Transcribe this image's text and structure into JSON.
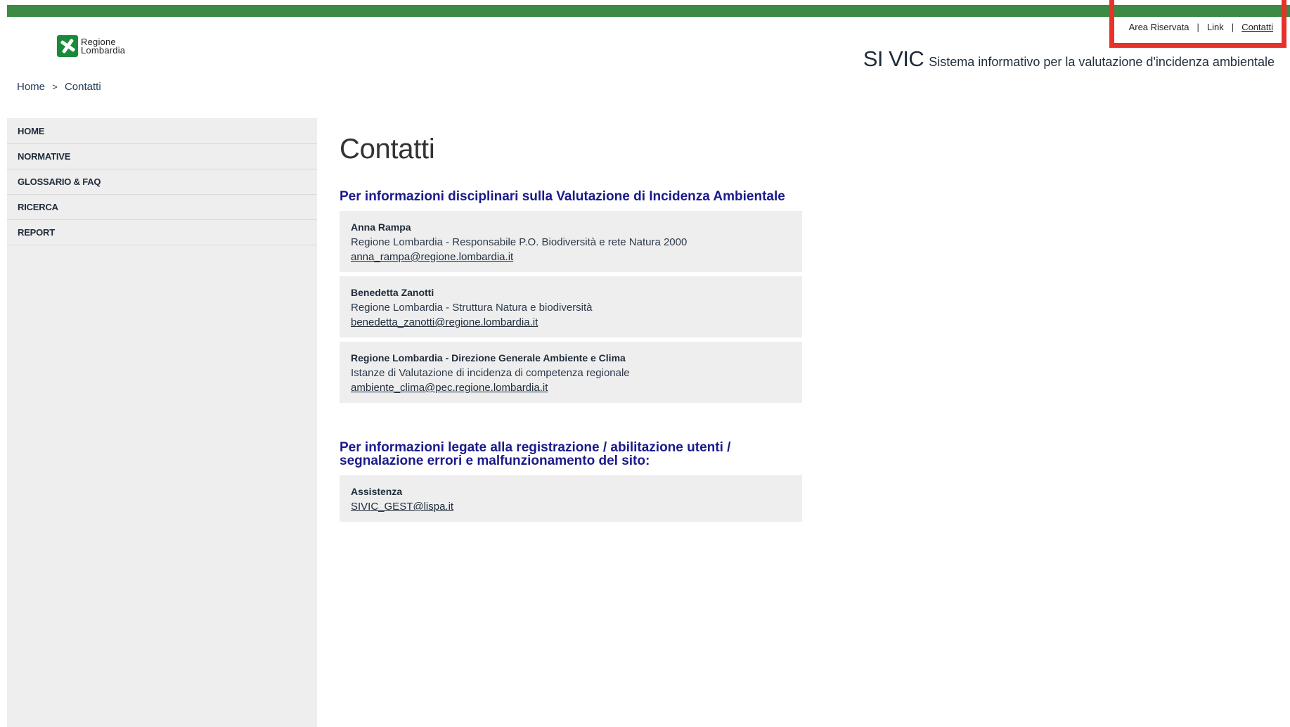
{
  "logo": {
    "line1": "Regione",
    "line2": "Lombardia"
  },
  "utility_links": [
    {
      "label": "Area Riservata"
    },
    {
      "label": "Link"
    },
    {
      "label": "Contatti"
    }
  ],
  "utility_separator": "|",
  "site_title": {
    "short": "SI VIC",
    "long": "Sistema informativo per la valutazione d'incidenza ambientale"
  },
  "breadcrumb": {
    "home": "Home",
    "separator": ">",
    "current": "Contatti"
  },
  "sidebar": {
    "items": [
      {
        "label": "HOME"
      },
      {
        "label": "NORMATIVE"
      },
      {
        "label": "GLOSSARIO & FAQ"
      },
      {
        "label": "RICERCA"
      },
      {
        "label": "REPORT"
      }
    ]
  },
  "page": {
    "title": "Contatti",
    "sections": [
      {
        "title": "Per informazioni disciplinari sulla Valutazione di Incidenza Ambientale",
        "contacts": [
          {
            "name": "Anna Rampa",
            "description": "Regione Lombardia - Responsabile P.O. Biodiversità e rete Natura 2000",
            "email": "anna_rampa@regione.lombardia.it"
          },
          {
            "name": "Benedetta Zanotti",
            "description": "Regione Lombardia - Struttura Natura e biodiversità",
            "email": "benedetta_zanotti@regione.lombardia.it"
          },
          {
            "name": "Regione Lombardia - Direzione Generale Ambiente e Clima",
            "description": "Istanze di Valutazione di incidenza di competenza regionale",
            "email": "ambiente_clima@pec.regione.lombardia.it"
          }
        ]
      },
      {
        "title": "Per informazioni legate alla registrazione / abilitazione utenti / segnalazione errori e malfunzionamento del sito:",
        "contacts": [
          {
            "name": "Assistenza",
            "email": "SIVIC_GEST@lispa.it"
          }
        ]
      }
    ]
  },
  "colors": {
    "top_bar": "#3c8a44",
    "highlight": "#e7312b",
    "section_title": "#1a1a8c",
    "card_bg": "#eeeeee",
    "sidebar_bg": "#eeeeee"
  }
}
